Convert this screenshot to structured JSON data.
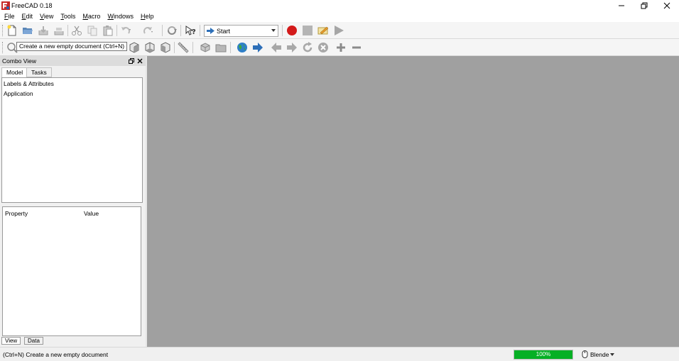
{
  "window": {
    "title": "FreeCAD 0.18"
  },
  "menu": {
    "items": [
      {
        "label": "File",
        "accel": "F",
        "rest": "ile"
      },
      {
        "label": "Edit",
        "accel": "E",
        "rest": "dit"
      },
      {
        "label": "View",
        "accel": "V",
        "rest": "iew"
      },
      {
        "label": "Tools",
        "accel": "T",
        "rest": "ools"
      },
      {
        "label": "Macro",
        "accel": "M",
        "rest": "acro"
      },
      {
        "label": "Windows",
        "accel": "W",
        "rest": "indows"
      },
      {
        "label": "Help",
        "accel": "H",
        "rest": "elp"
      }
    ]
  },
  "toolbar": {
    "workbench_selected": "Start",
    "tooltip": "Create a new empty document (Ctrl+N)"
  },
  "combo_view": {
    "title": "Combo View",
    "tabs": [
      "Model",
      "Tasks"
    ],
    "tree_items": [
      "Labels & Attributes",
      "Application"
    ],
    "property_headers": {
      "property": "Property",
      "value": "Value"
    },
    "bottom_tabs": [
      "View",
      "Data"
    ]
  },
  "statusbar": {
    "message": "(Ctrl+N) Create a new empty document",
    "progress_text": "100%",
    "progress_value": 100,
    "navigation_style": "Blende"
  },
  "colors": {
    "viewport_bg": "#a0a0a0",
    "progress_fill": "#06b025",
    "macro_record": "#d31a1a"
  }
}
